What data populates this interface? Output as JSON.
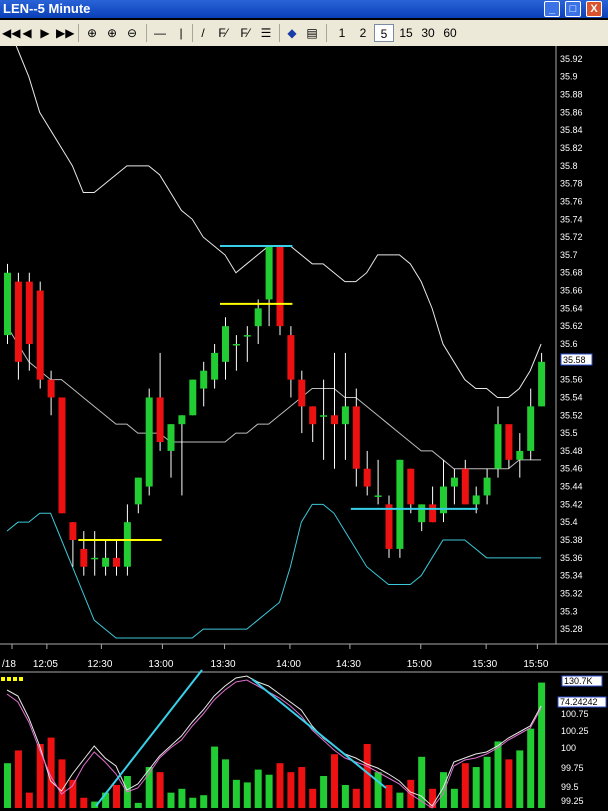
{
  "window": {
    "title": "LEN--5 Minute",
    "min": "_",
    "max": "□",
    "close": "X"
  },
  "toolbar": {
    "nav": [
      "◀◀",
      "◀",
      "▶",
      "▶▶"
    ],
    "tools": [
      "⊕",
      "⊕",
      "⊖",
      "—",
      "|",
      "/",
      "F⁄",
      "F⁄",
      "☰",
      "◆",
      "▤"
    ],
    "intervals": [
      "1",
      "2",
      "5",
      "15",
      "30",
      "60"
    ],
    "selected_interval": "5"
  },
  "price_axis": {
    "labels": [
      "35.92",
      "35.9",
      "35.88",
      "35.86",
      "35.84",
      "35.82",
      "35.8",
      "35.78",
      "35.76",
      "35.74",
      "35.72",
      "35.7",
      "35.68",
      "35.66",
      "35.64",
      "35.62",
      "35.6",
      "35.58",
      "35.56",
      "35.54",
      "35.52",
      "35.5",
      "35.48",
      "35.46",
      "35.44",
      "35.42",
      "35.4",
      "35.38",
      "35.36",
      "35.34",
      "35.32",
      "35.3",
      "35.28"
    ],
    "current_price": "35.58"
  },
  "time_axis": {
    "labels": [
      "/18",
      "12:05",
      "12:30",
      "13:00",
      "13:30",
      "14:00",
      "14:30",
      "15:00",
      "15:30",
      "15:50"
    ]
  },
  "lower_panel": {
    "axis_labels": [
      "100.75",
      "100.25",
      "100",
      "99.75",
      "99.5",
      "99.25"
    ],
    "volume_badge": "130.7K",
    "indicator_badge": "74.24242"
  },
  "colors": {
    "up": "#22cc33",
    "down": "#ee1111",
    "band": "#e8e8e8",
    "lower_band": "#3cc8d8",
    "cyan": "#38d0e8",
    "yellow": "#ffff00",
    "pink": "#e070d0"
  },
  "chart_data": {
    "type": "candlestick",
    "title": "LEN--5 Minute",
    "ylim": [
      35.27,
      35.93
    ],
    "candles": [
      {
        "o": 35.61,
        "h": 35.69,
        "l": 35.6,
        "c": 35.68
      },
      {
        "o": 35.67,
        "h": 35.68,
        "l": 35.56,
        "c": 35.58
      },
      {
        "o": 35.67,
        "h": 35.68,
        "l": 35.57,
        "c": 35.6
      },
      {
        "o": 35.66,
        "h": 35.67,
        "l": 35.55,
        "c": 35.56
      },
      {
        "o": 35.56,
        "h": 35.57,
        "l": 35.52,
        "c": 35.54
      },
      {
        "o": 35.54,
        "h": 35.54,
        "l": 35.41,
        "c": 35.41
      },
      {
        "o": 35.4,
        "h": 35.4,
        "l": 35.35,
        "c": 35.38
      },
      {
        "o": 35.37,
        "h": 35.39,
        "l": 35.34,
        "c": 35.35
      },
      {
        "o": 35.36,
        "h": 35.39,
        "l": 35.34,
        "c": 35.36
      },
      {
        "o": 35.35,
        "h": 35.38,
        "l": 35.34,
        "c": 35.36
      },
      {
        "o": 35.36,
        "h": 35.38,
        "l": 35.34,
        "c": 35.35
      },
      {
        "o": 35.35,
        "h": 35.42,
        "l": 35.34,
        "c": 35.4
      },
      {
        "o": 35.42,
        "h": 35.45,
        "l": 35.41,
        "c": 35.45
      },
      {
        "o": 35.44,
        "h": 35.55,
        "l": 35.43,
        "c": 35.54
      },
      {
        "o": 35.54,
        "h": 35.59,
        "l": 35.48,
        "c": 35.49
      },
      {
        "o": 35.48,
        "h": 35.51,
        "l": 35.45,
        "c": 35.51
      },
      {
        "o": 35.51,
        "h": 35.52,
        "l": 35.43,
        "c": 35.52
      },
      {
        "o": 35.52,
        "h": 35.56,
        "l": 35.52,
        "c": 35.56
      },
      {
        "o": 35.55,
        "h": 35.58,
        "l": 35.53,
        "c": 35.57
      },
      {
        "o": 35.56,
        "h": 35.6,
        "l": 35.55,
        "c": 35.59
      },
      {
        "o": 35.58,
        "h": 35.63,
        "l": 35.56,
        "c": 35.62
      },
      {
        "o": 35.6,
        "h": 35.61,
        "l": 35.57,
        "c": 35.6
      },
      {
        "o": 35.61,
        "h": 35.62,
        "l": 35.58,
        "c": 35.61
      },
      {
        "o": 35.62,
        "h": 35.65,
        "l": 35.6,
        "c": 35.64
      },
      {
        "o": 35.65,
        "h": 35.71,
        "l": 35.62,
        "c": 35.71
      },
      {
        "o": 35.71,
        "h": 35.71,
        "l": 35.61,
        "c": 35.62
      },
      {
        "o": 35.61,
        "h": 35.62,
        "l": 35.54,
        "c": 35.56
      },
      {
        "o": 35.56,
        "h": 35.57,
        "l": 35.5,
        "c": 35.53
      },
      {
        "o": 35.53,
        "h": 35.53,
        "l": 35.49,
        "c": 35.51
      },
      {
        "o": 35.52,
        "h": 35.56,
        "l": 35.47,
        "c": 35.52
      },
      {
        "o": 35.52,
        "h": 35.59,
        "l": 35.46,
        "c": 35.51
      },
      {
        "o": 35.51,
        "h": 35.59,
        "l": 35.47,
        "c": 35.53
      },
      {
        "o": 35.53,
        "h": 35.55,
        "l": 35.44,
        "c": 35.46
      },
      {
        "o": 35.46,
        "h": 35.48,
        "l": 35.43,
        "c": 35.44
      },
      {
        "o": 35.43,
        "h": 35.47,
        "l": 35.42,
        "c": 35.43
      },
      {
        "o": 35.42,
        "h": 35.43,
        "l": 35.36,
        "c": 35.37
      },
      {
        "o": 35.37,
        "h": 35.47,
        "l": 35.36,
        "c": 35.47
      },
      {
        "o": 35.46,
        "h": 35.46,
        "l": 35.41,
        "c": 35.42
      },
      {
        "o": 35.4,
        "h": 35.42,
        "l": 35.39,
        "c": 35.42
      },
      {
        "o": 35.42,
        "h": 35.44,
        "l": 35.4,
        "c": 35.4
      },
      {
        "o": 35.41,
        "h": 35.47,
        "l": 35.4,
        "c": 35.44
      },
      {
        "o": 35.44,
        "h": 35.46,
        "l": 35.42,
        "c": 35.45
      },
      {
        "o": 35.46,
        "h": 35.47,
        "l": 35.43,
        "c": 35.42
      },
      {
        "o": 35.42,
        "h": 35.44,
        "l": 35.41,
        "c": 35.43
      },
      {
        "o": 35.43,
        "h": 35.46,
        "l": 35.42,
        "c": 35.45
      },
      {
        "o": 35.46,
        "h": 35.53,
        "l": 35.45,
        "c": 35.51
      },
      {
        "o": 35.51,
        "h": 35.5,
        "l": 35.46,
        "c": 35.47
      },
      {
        "o": 35.47,
        "h": 35.5,
        "l": 35.45,
        "c": 35.48
      },
      {
        "o": 35.48,
        "h": 35.55,
        "l": 35.47,
        "c": 35.53
      },
      {
        "o": 35.53,
        "h": 35.59,
        "l": 35.53,
        "c": 35.58
      }
    ],
    "upper_band": [
      35.96,
      35.93,
      35.9,
      35.86,
      35.84,
      35.82,
      35.8,
      35.77,
      35.77,
      35.78,
      35.79,
      35.8,
      35.8,
      35.8,
      35.79,
      35.77,
      35.75,
      35.74,
      35.72,
      35.71,
      35.7,
      35.68,
      35.69,
      35.7,
      35.71,
      35.71,
      35.71,
      35.7,
      35.69,
      35.69,
      35.68,
      35.67,
      35.67,
      35.68,
      35.7,
      35.7,
      35.7,
      35.69,
      35.67,
      35.64,
      35.6,
      35.58,
      35.56,
      35.55,
      35.55,
      35.54,
      35.54,
      35.55,
      35.57,
      35.6
    ],
    "middle_band": [
      35.62,
      35.6,
      35.58,
      35.57,
      35.56,
      35.56,
      35.55,
      35.54,
      35.53,
      35.52,
      35.51,
      35.51,
      35.5,
      35.5,
      35.5,
      35.49,
      35.49,
      35.49,
      35.49,
      35.49,
      35.49,
      35.5,
      35.5,
      35.51,
      35.51,
      35.52,
      35.53,
      35.54,
      35.55,
      35.55,
      35.55,
      35.54,
      35.54,
      35.53,
      35.52,
      35.51,
      35.5,
      35.49,
      35.48,
      35.48,
      35.47,
      35.46,
      35.46,
      35.46,
      35.46,
      35.46,
      35.46,
      35.47,
      35.47,
      35.47
    ],
    "lower_band": [
      35.39,
      35.4,
      35.4,
      35.41,
      35.41,
      35.38,
      35.35,
      35.32,
      35.29,
      35.28,
      35.27,
      35.27,
      35.27,
      35.27,
      35.27,
      35.27,
      35.27,
      35.27,
      35.28,
      35.28,
      35.28,
      35.28,
      35.28,
      35.29,
      35.3,
      35.31,
      35.35,
      35.4,
      35.42,
      35.42,
      35.41,
      35.39,
      35.37,
      35.35,
      35.34,
      35.33,
      35.33,
      35.33,
      35.34,
      35.36,
      35.38,
      35.38,
      35.38,
      35.37,
      35.36,
      35.36,
      35.36,
      35.36,
      35.36,
      35.36
    ],
    "horizontal_lines": [
      {
        "color": "yellow",
        "y": 35.38,
        "from": 7,
        "to": 14
      },
      {
        "color": "yellow",
        "y": 35.645,
        "from": 20,
        "to": 26
      },
      {
        "color": "cyan",
        "y": 35.71,
        "from": 20,
        "to": 26
      },
      {
        "color": "cyan",
        "y": 35.415,
        "from": 32,
        "to": 43
      }
    ],
    "volume": [
      0.35,
      0.45,
      0.12,
      0.5,
      0.55,
      0.38,
      0.22,
      0.08,
      0.05,
      0.12,
      0.18,
      0.25,
      0.04,
      0.32,
      0.28,
      0.12,
      0.15,
      0.08,
      0.1,
      0.48,
      0.38,
      0.22,
      0.2,
      0.3,
      0.26,
      0.35,
      0.28,
      0.32,
      0.15,
      0.25,
      0.42,
      0.18,
      0.15,
      0.5,
      0.28,
      0.18,
      0.12,
      0.22,
      0.4,
      0.15,
      0.28,
      0.15,
      0.35,
      0.32,
      0.4,
      0.52,
      0.38,
      0.45,
      0.62,
      0.98
    ]
  }
}
